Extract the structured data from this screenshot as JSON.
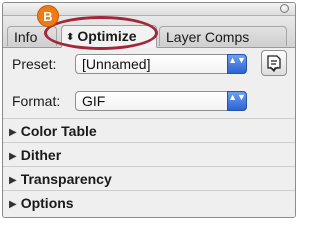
{
  "callout": {
    "letter": "B",
    "color": "#f07b14"
  },
  "highlight_color": "#a0283a",
  "tabs": {
    "info": "Info",
    "optimize": "Optimize",
    "layer_comps": "Layer Comps",
    "sort_glyph": "⬍"
  },
  "preset": {
    "label": "Preset:",
    "value": "[Unnamed]"
  },
  "format": {
    "label": "Format:",
    "value": "GIF"
  },
  "select_arrows": "▲▼",
  "sections": [
    {
      "label": "Color Table",
      "glyph": "▶"
    },
    {
      "label": "Dither",
      "glyph": "▶"
    },
    {
      "label": "Transparency",
      "glyph": "▶"
    },
    {
      "label": "Options",
      "glyph": "▶"
    }
  ],
  "icons": {
    "close": "close-icon",
    "palette_menu": "palette-menu-icon",
    "disclosure": "disclosure-triangle-icon"
  }
}
